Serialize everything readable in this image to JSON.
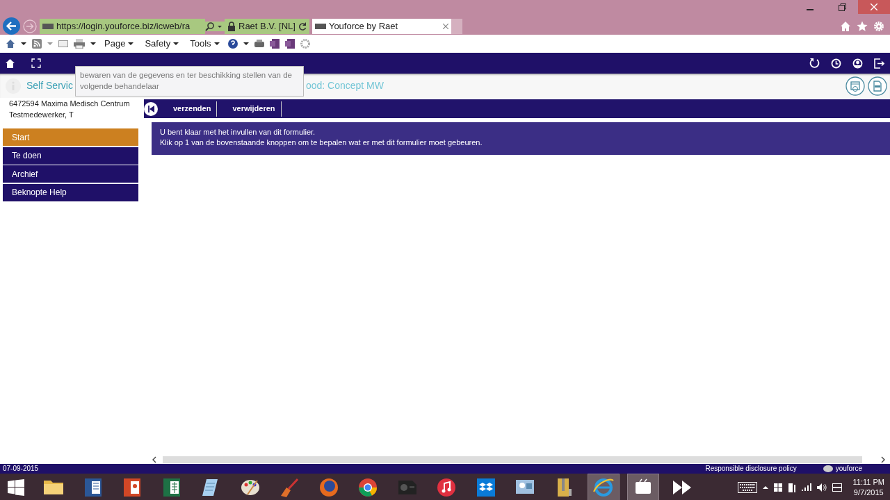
{
  "browser": {
    "url": "https://login.youforce.biz/icweb/ra",
    "site_identity": "Raet B.V. [NL]",
    "tab": {
      "title": "Youforce by Raet",
      "selected": true
    },
    "command_menus": [
      "Page",
      "Safety",
      "Tools"
    ]
  },
  "app": {
    "breadcrumb": "Self Servic",
    "form_title": "ood: Concept MW",
    "tooltip": "bewaren van de gegevens en ter beschikking stellen van de volgende behandelaar",
    "user_lines": [
      "6472594 Maxima Medisch Centrum",
      "Testmedewerker, T"
    ],
    "nav": [
      {
        "label": "Start",
        "selected": true
      },
      {
        "label": "Te doen",
        "selected": false
      },
      {
        "label": "Archief",
        "selected": false
      },
      {
        "label": "Beknopte Help",
        "selected": false
      }
    ],
    "actions": [
      "verzenden",
      "verwijderen"
    ],
    "message": [
      "U bent klaar met het invullen van dit formulier.",
      "Klik op 1 van de bovenstaande knoppen om te bepalen wat er met dit formulier moet gebeuren."
    ],
    "footer": {
      "date": "07-09-2015",
      "link": "Responsible disclosure policy",
      "brand": "youforce"
    }
  },
  "taskbar": {
    "apps": [
      {
        "kind": "folder",
        "active": false
      },
      {
        "kind": "word",
        "active": false
      },
      {
        "kind": "slides",
        "active": false
      },
      {
        "kind": "sheet",
        "active": false
      },
      {
        "kind": "notepad",
        "active": false
      },
      {
        "kind": "palette",
        "active": false
      },
      {
        "kind": "broom",
        "active": false
      },
      {
        "kind": "firefox",
        "active": false
      },
      {
        "kind": "chrome",
        "active": false
      },
      {
        "kind": "projector",
        "active": false
      },
      {
        "kind": "music",
        "active": false
      },
      {
        "kind": "dropbox",
        "active": false
      },
      {
        "kind": "remote",
        "active": false
      },
      {
        "kind": "archive",
        "active": false
      },
      {
        "kind": "ie",
        "active": true
      },
      {
        "kind": "video",
        "active": true
      },
      {
        "kind": "forward",
        "active": false
      }
    ],
    "time": "11:11 PM",
    "date": "9/7/2015"
  }
}
